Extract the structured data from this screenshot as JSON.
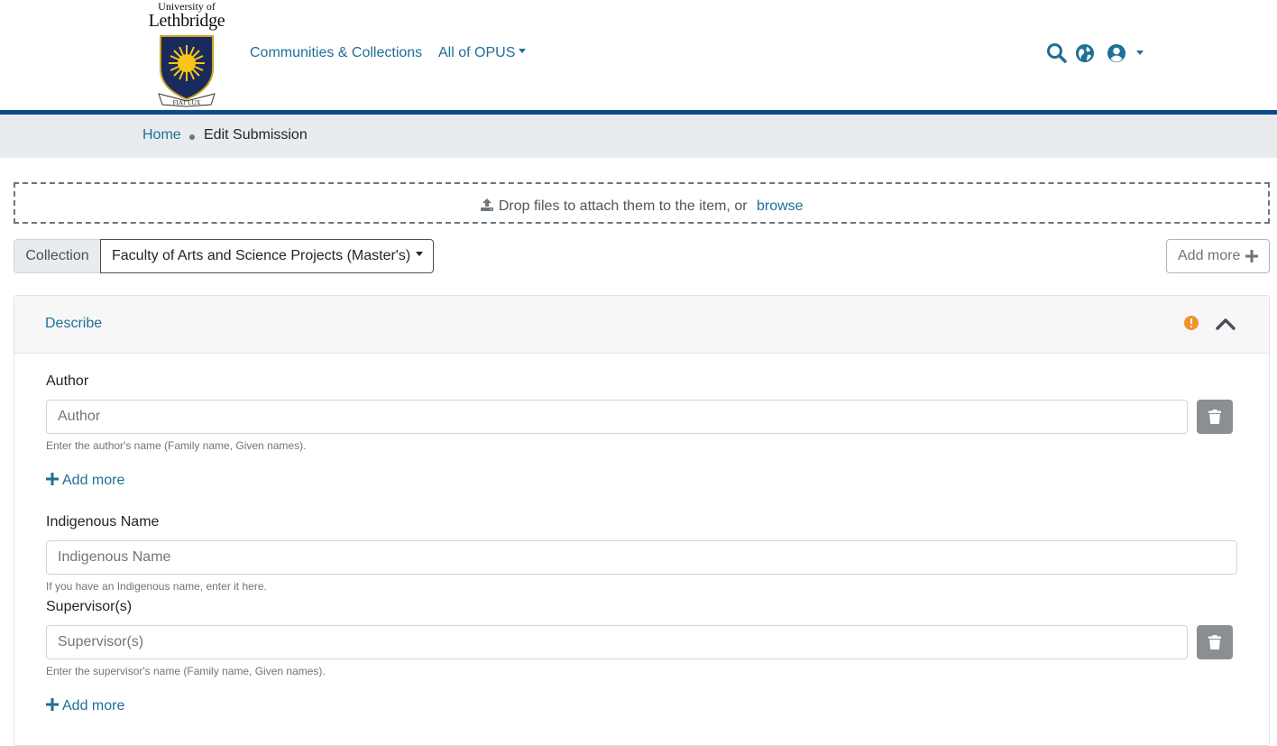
{
  "header": {
    "logo_top_text": "University of",
    "logo_main_text": "Lethbridge",
    "logo_motto": "FIAT LUX",
    "nav": [
      {
        "label": "Communities & Collections"
      },
      {
        "label": "All of OPUS"
      }
    ],
    "icons": [
      "search-icon",
      "globe-icon",
      "user-circle-icon"
    ],
    "bar_color": "#0c4a8d"
  },
  "breadcrumb": {
    "home": "Home",
    "current": "Edit Submission"
  },
  "dropzone": {
    "text": "Drop files to attach them to the item, or",
    "browse": "browse"
  },
  "collection": {
    "label": "Collection",
    "selected": "Faculty of Arts and Science Projects (Master's)",
    "add_more": "Add more"
  },
  "section": {
    "title": "Describe",
    "warning_color": "#f0932b"
  },
  "fields": {
    "author": {
      "label": "Author",
      "placeholder": "Author",
      "help": "Enter the author's name (Family name, Given names).",
      "add_more": "Add more"
    },
    "indigenous": {
      "label": "Indigenous Name",
      "placeholder": "Indigenous Name",
      "help": "If you have an Indigenous name, enter it here."
    },
    "supervisor": {
      "label": "Supervisor(s)",
      "placeholder": "Supervisor(s)",
      "help": "Enter the supervisor's name (Family name, Given names).",
      "add_more": "Add more"
    }
  },
  "colors": {
    "link": "#1e6f97",
    "breadcrumb_bg": "#e8ecef"
  }
}
